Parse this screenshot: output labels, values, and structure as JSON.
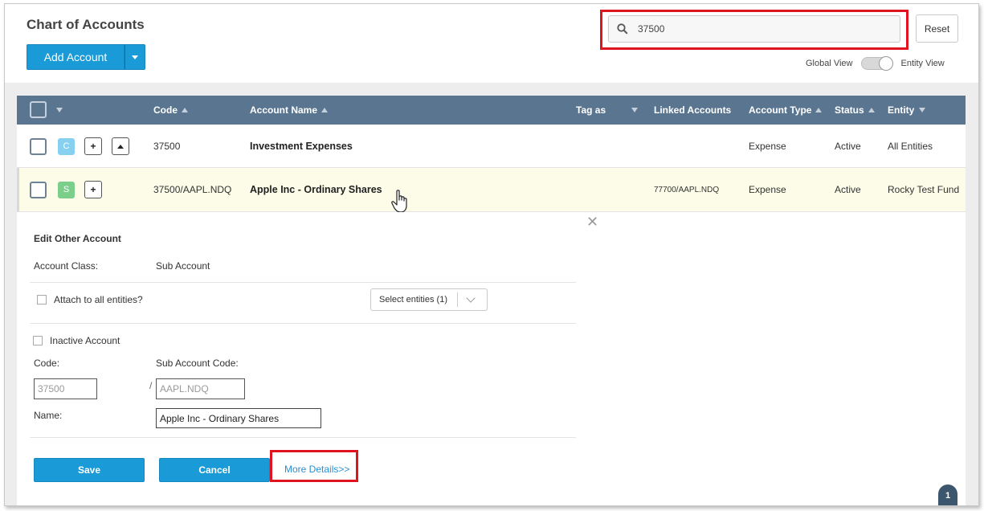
{
  "header": {
    "title": "Chart of Accounts",
    "add_button_label": "Add Account",
    "search": {
      "value": "37500",
      "placeholder": ""
    },
    "reset_label": "Reset",
    "view_toggle": {
      "left_label": "Global View",
      "right_label": "Entity View",
      "selected": "Entity View"
    }
  },
  "table": {
    "columns": {
      "code": "Code",
      "account_name": "Account Name",
      "tag_as": "Tag as",
      "linked_accounts": "Linked Accounts",
      "account_type": "Account Type",
      "status": "Status",
      "entity": "Entity"
    },
    "rows": [
      {
        "badge": "C",
        "code": "37500",
        "account_name": "Investment Expenses",
        "linked_accounts": "",
        "account_type": "Expense",
        "status": "Active",
        "entity": "All Entities"
      },
      {
        "badge": "S",
        "code": "37500/AAPL.NDQ",
        "account_name": "Apple Inc - Ordinary Shares",
        "linked_accounts": "77700/AAPL.NDQ",
        "account_type": "Expense",
        "status": "Active",
        "entity": "Rocky Test Fund"
      }
    ]
  },
  "edit_panel": {
    "title": "Edit Other Account",
    "account_class_label": "Account Class:",
    "account_class_value": "Sub Account",
    "attach_all_label": "Attach to all entities?",
    "select_entities_label": "Select entities (1)",
    "inactive_label": "Inactive Account",
    "code_label": "Code:",
    "sub_code_label": "Sub Account Code:",
    "code_value": "37500",
    "separator": "/",
    "sub_code_value": "AAPL.NDQ",
    "name_label": "Name:",
    "name_value": "Apple Inc - Ordinary Shares",
    "save_label": "Save",
    "cancel_label": "Cancel",
    "more_details_label": "More Details>>"
  },
  "pagination": {
    "current_page": "1"
  },
  "colors": {
    "primary_button": "#1a9ad6",
    "table_header": "#5a7590",
    "highlight_box": "#e0141e",
    "badge_c": "#88d0f0",
    "badge_s": "#7ccf8a",
    "selected_row": "#fcfce8"
  },
  "icons": [
    "search-icon",
    "caret-down-icon",
    "close-icon",
    "hand-cursor-icon",
    "chevron-down-icon"
  ]
}
